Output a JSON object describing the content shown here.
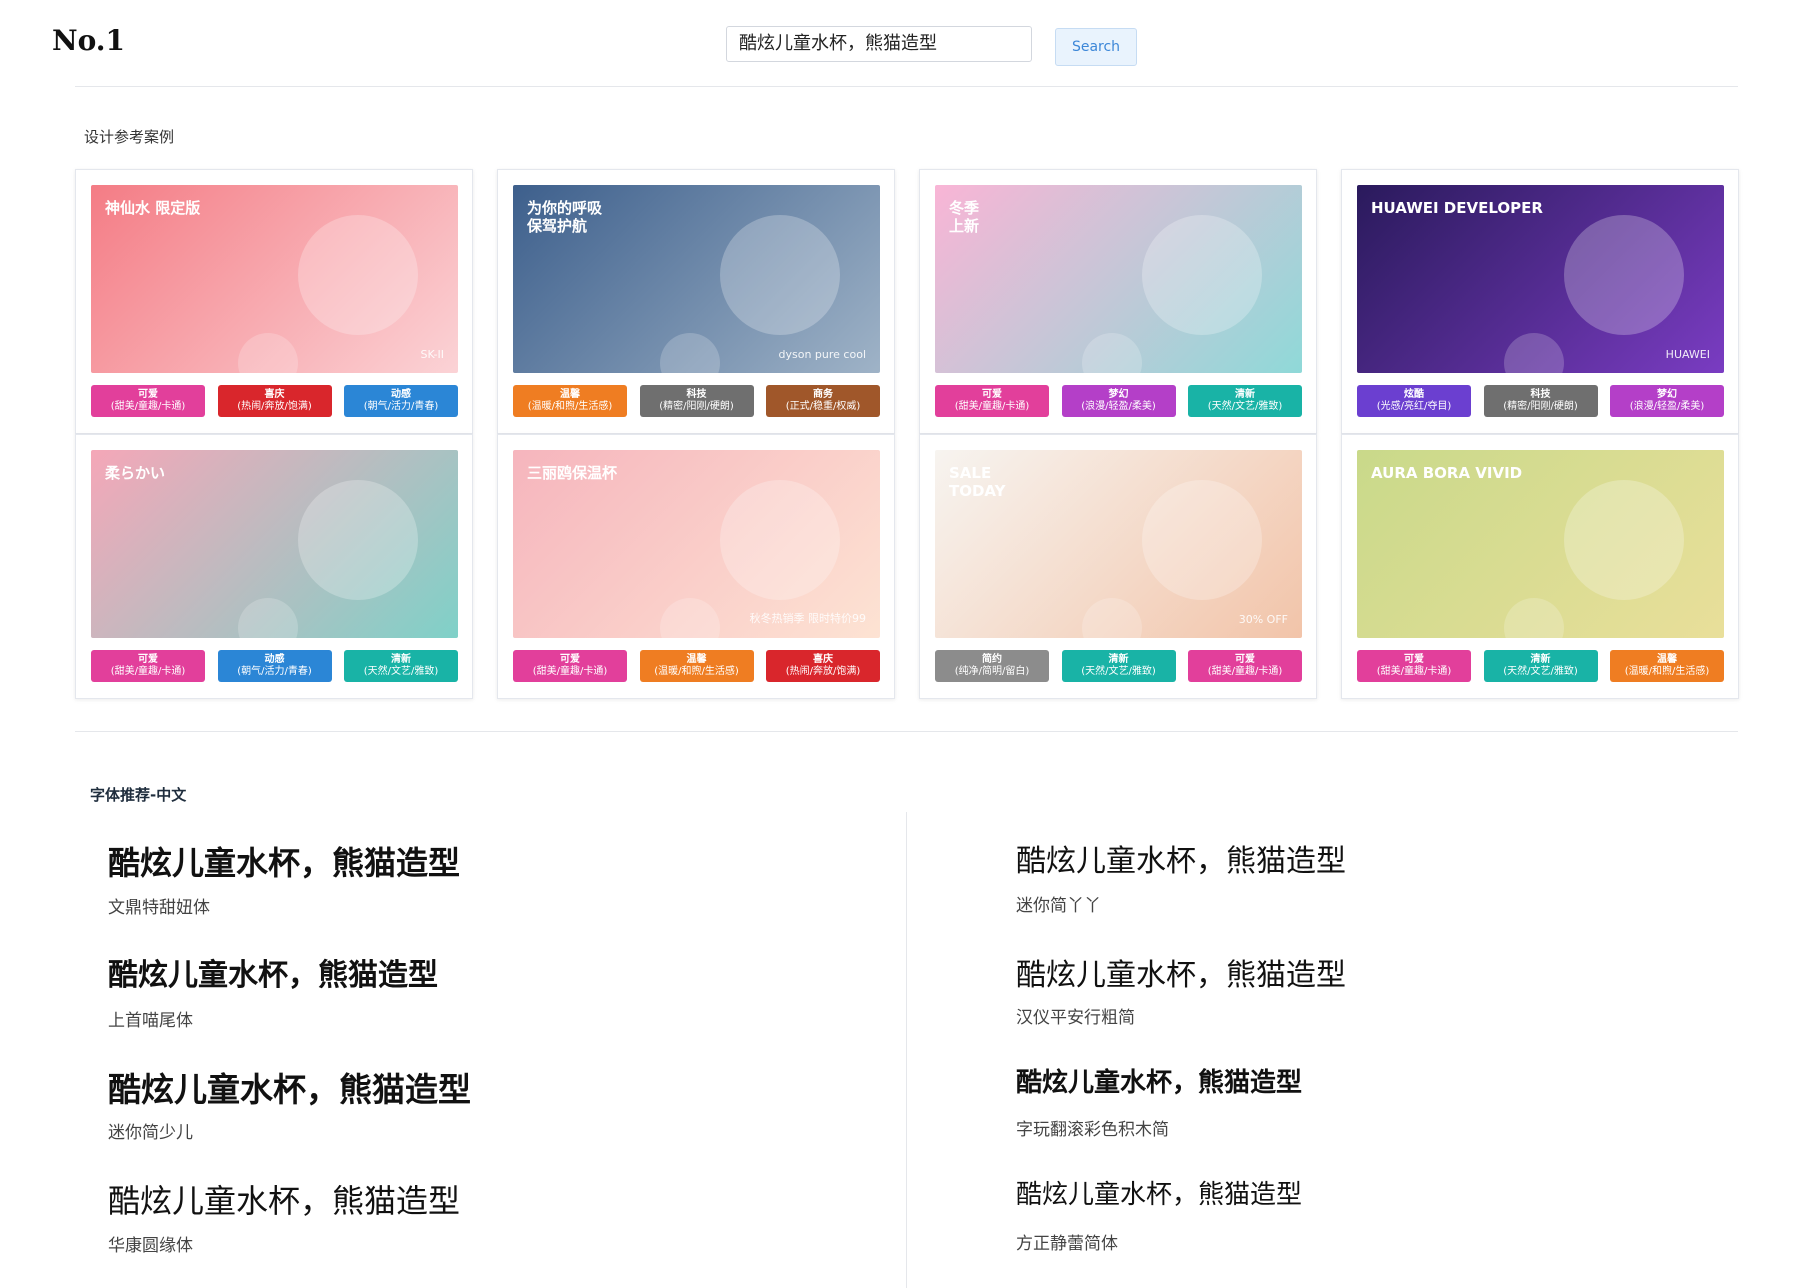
{
  "header": {
    "logo": "No.1",
    "search_value": "酷炫儿童水杯，熊猫造型",
    "search_button": "Search"
  },
  "cases": {
    "title": "设计参考案例",
    "cards": [
      {
        "banner_text": "神仙水 限定版",
        "banner_sub": "SK-II",
        "colors": [
          "#f47c85",
          "#fbd3d6"
        ],
        "tags": [
          {
            "name": "可爱",
            "desc": "(甜美/童趣/卡通)",
            "color": "#e23f9b"
          },
          {
            "name": "喜庆",
            "desc": "(热闹/奔放/饱满)",
            "color": "#d9262c"
          },
          {
            "name": "动感",
            "desc": "(朝气/活力/青春)",
            "color": "#2b86d6"
          }
        ]
      },
      {
        "banner_text": "为你的呼吸\n保驾护航",
        "banner_sub": "dyson pure cool",
        "colors": [
          "#3d5f8c",
          "#9fb3c7"
        ],
        "tags": [
          {
            "name": "温馨",
            "desc": "(温暖/和煦/生活感)",
            "color": "#ef7d22"
          },
          {
            "name": "科技",
            "desc": "(精密/阳刚/硬朗)",
            "color": "#6f6f6f"
          },
          {
            "name": "商务",
            "desc": "(正式/稳重/权威)",
            "color": "#a0572a"
          }
        ]
      },
      {
        "banner_text": "冬季\n上新",
        "banner_sub": "",
        "colors": [
          "#f9b5d6",
          "#8fd9d8"
        ],
        "tags": [
          {
            "name": "可爱",
            "desc": "(甜美/童趣/卡通)",
            "color": "#e23f9b"
          },
          {
            "name": "梦幻",
            "desc": "(浪漫/轻盈/柔美)",
            "color": "#b43fc8"
          },
          {
            "name": "清新",
            "desc": "(天然/文艺/雅致)",
            "color": "#19b3a6"
          }
        ]
      },
      {
        "banner_text": "HUAWEI DEVELOPER",
        "banner_sub": "HUAWEI",
        "colors": [
          "#2a1a5c",
          "#7a3cc2"
        ],
        "tags": [
          {
            "name": "炫酷",
            "desc": "(光感/亮红/夺目)",
            "color": "#6b3fd0"
          },
          {
            "name": "科技",
            "desc": "(精密/阳刚/硬朗)",
            "color": "#6f6f6f"
          },
          {
            "name": "梦幻",
            "desc": "(浪漫/轻盈/柔美)",
            "color": "#b43fc8"
          }
        ]
      },
      {
        "banner_text": "柔らかい",
        "banner_sub": "",
        "colors": [
          "#f5a7b8",
          "#7fd1c8"
        ],
        "tags": [
          {
            "name": "可爱",
            "desc": "(甜美/童趣/卡通)",
            "color": "#e23f9b"
          },
          {
            "name": "动感",
            "desc": "(朝气/活力/青春)",
            "color": "#2b86d6"
          },
          {
            "name": "清新",
            "desc": "(天然/文艺/雅致)",
            "color": "#19b3a6"
          }
        ]
      },
      {
        "banner_text": "三丽鸥保温杯",
        "banner_sub": "秋冬热销季 限时特价99",
        "colors": [
          "#f6b5bd",
          "#fde3d3"
        ],
        "tags": [
          {
            "name": "可爱",
            "desc": "(甜美/童趣/卡通)",
            "color": "#e23f9b"
          },
          {
            "name": "温馨",
            "desc": "(温暖/和煦/生活感)",
            "color": "#ef7d22"
          },
          {
            "name": "喜庆",
            "desc": "(热闹/奔放/饱满)",
            "color": "#d9262c"
          }
        ]
      },
      {
        "banner_text": "SALE\nTODAY",
        "banner_sub": "30% OFF",
        "colors": [
          "#f7f4f0",
          "#f2c4a9"
        ],
        "tags": [
          {
            "name": "简约",
            "desc": "(纯净/简明/留白)",
            "color": "#8c8c8c"
          },
          {
            "name": "清新",
            "desc": "(天然/文艺/雅致)",
            "color": "#19b3a6"
          },
          {
            "name": "可爱",
            "desc": "(甜美/童趣/卡通)",
            "color": "#e23f9b"
          }
        ]
      },
      {
        "banner_text": "AURA BORA VIVID",
        "banner_sub": "",
        "colors": [
          "#c9d98a",
          "#e9df9a"
        ],
        "tags": [
          {
            "name": "可爱",
            "desc": "(甜美/童趣/卡通)",
            "color": "#e23f9b"
          },
          {
            "name": "清新",
            "desc": "(天然/文艺/雅致)",
            "color": "#19b3a6"
          },
          {
            "name": "温馨",
            "desc": "(温暖/和煦/生活感)",
            "color": "#ef7d22"
          }
        ]
      }
    ]
  },
  "fonts": {
    "title": "字体推荐-中文",
    "sample_text": "酷炫儿童水杯，熊猫造型",
    "left": [
      "文鼎特甜妞体",
      "上首喵尾体",
      "迷你简少儿",
      "华康圆缘体"
    ],
    "right": [
      "迷你简丫丫",
      "汉仪平安行粗简",
      "字玩翻滚彩色积木简",
      "方正静蕾简体"
    ]
  }
}
